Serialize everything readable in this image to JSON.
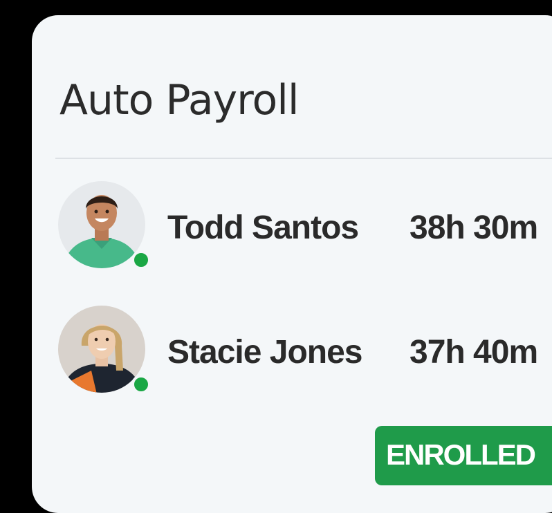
{
  "panel": {
    "title": "Auto Payroll"
  },
  "employees": [
    {
      "name": "Todd Santos",
      "hours": "38h 30m",
      "status": "online",
      "avatar_icon": "person-avatar-icon"
    },
    {
      "name": "Stacie Jones",
      "hours": "37h 40m",
      "status": "online",
      "avatar_icon": "person-avatar-icon"
    }
  ],
  "badge": {
    "label": "ENROLLED"
  },
  "colors": {
    "background": "#000000",
    "card": "#f4f7f9",
    "text": "#2a2a2a",
    "accent_green": "#1f9b4a",
    "status_online": "#1aa745"
  }
}
